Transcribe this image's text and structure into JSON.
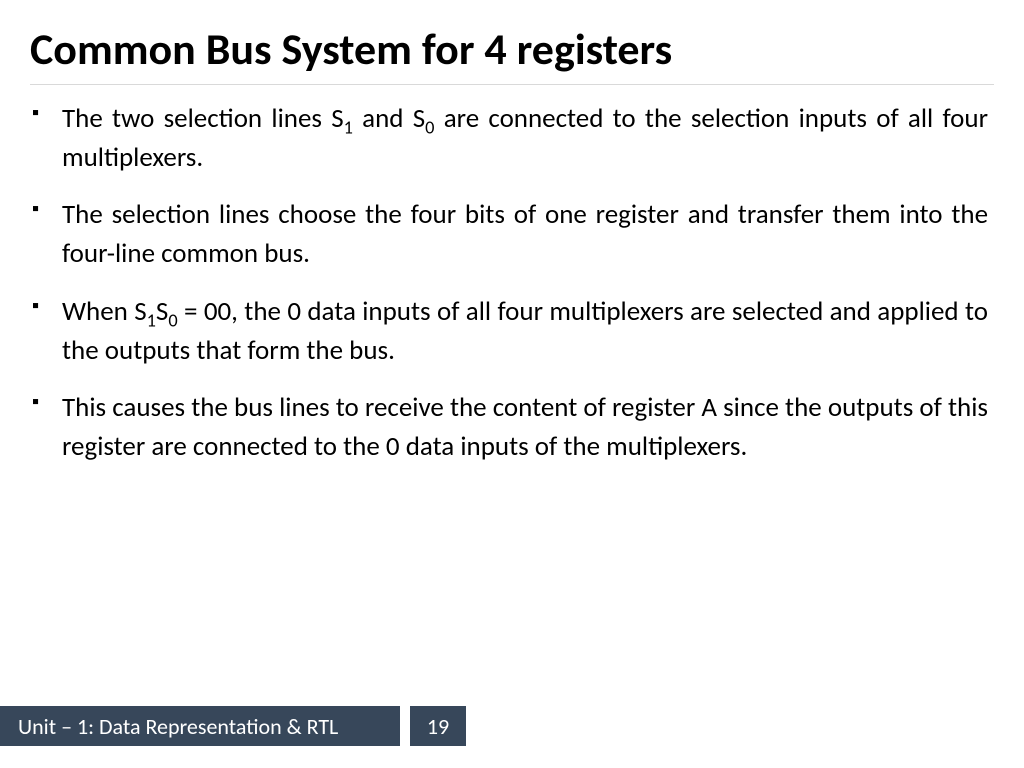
{
  "title": "Common Bus System for 4 registers",
  "bullets": [
    {
      "pre": "The two selection lines S",
      "sub1": "1",
      "mid": " and S",
      "sub2": "0",
      "post": " are connected to the selection inputs of all four multiplexers."
    },
    {
      "text": "The selection lines choose the four bits of one register and transfer them into the four-line common bus."
    },
    {
      "pre": "When S",
      "sub1": "1",
      "mid": "S",
      "sub2": "0",
      "post": " = 00, the 0 data inputs of all four multiplexers are selected and applied to the outputs that form the bus."
    },
    {
      "text": "This causes the bus lines to receive the content of register A since the outputs of this register are connected to the 0 data inputs of the multiplexers."
    }
  ],
  "footer": {
    "unit": "Unit – 1: Data Representation & RTL",
    "page": "19"
  }
}
